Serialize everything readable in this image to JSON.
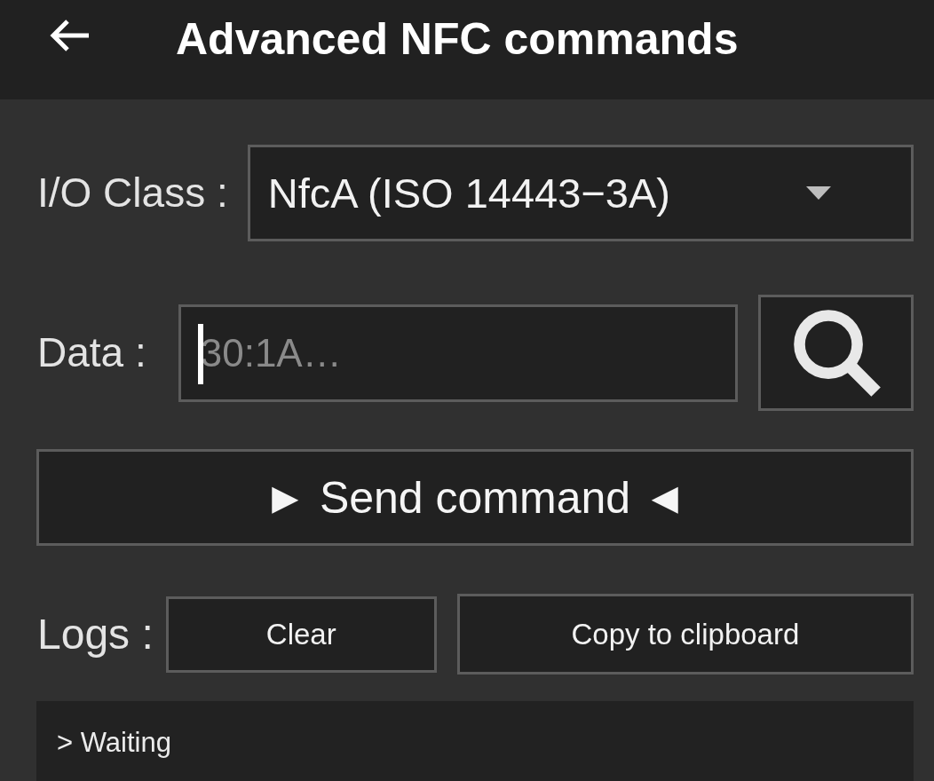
{
  "app_bar": {
    "title": "Advanced NFC commands"
  },
  "io_class": {
    "label": "I/O Class :",
    "value": "NfcA (ISO 14443−3A)"
  },
  "data": {
    "label": "Data :",
    "placeholder": "30:1A…",
    "focused": true
  },
  "send_button": {
    "label": "► Send command ◄"
  },
  "logs": {
    "label": "Logs :",
    "buttons": [
      "Clear",
      "Copy to clipboard"
    ],
    "lines": [
      "> Waiting"
    ]
  }
}
